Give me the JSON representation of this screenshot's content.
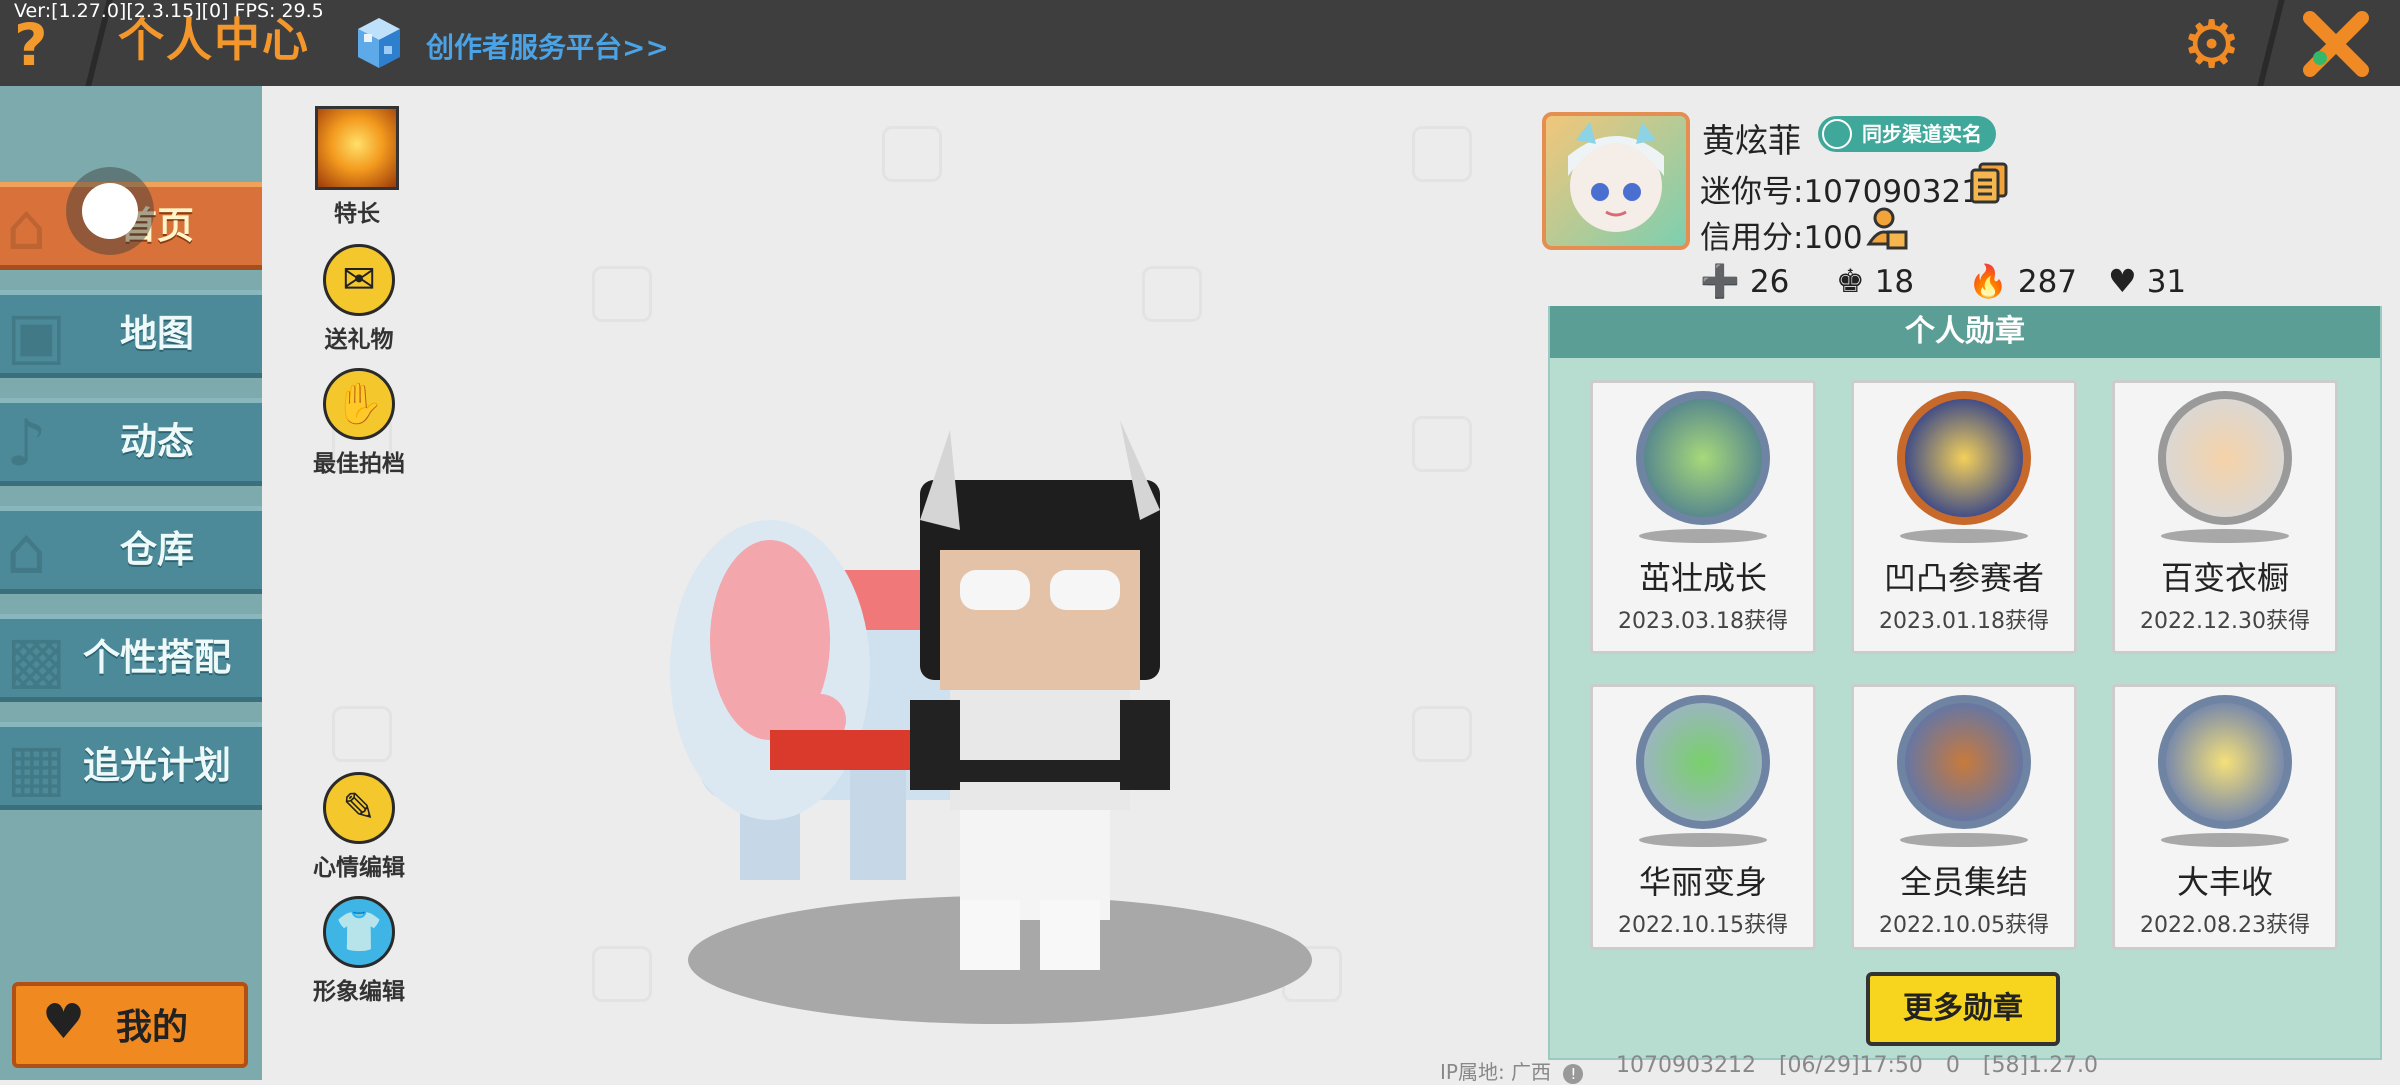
{
  "topbar": {
    "version": "Ver:[1.27.0][2.3.15][0] FPS: 29.5",
    "help_icon": "?",
    "title": "个人中心",
    "creator_platform": "创作者服务平台>>",
    "gear_icon": "⚙",
    "close_icon": "close-icon"
  },
  "sidebar": {
    "items": [
      {
        "label": "首页",
        "active": true
      },
      {
        "label": "地图"
      },
      {
        "label": "动态"
      },
      {
        "label": "仓库"
      },
      {
        "label": "个性搭配"
      },
      {
        "label": "追光计划"
      }
    ],
    "mine_label": "我的"
  },
  "functions": {
    "talent": "特长",
    "gift": "送礼物",
    "partner": "最佳拍档",
    "mood": "心情编辑",
    "image": "形象编辑"
  },
  "profile": {
    "username": "黄炫菲",
    "sync_label": "同步渠道实名",
    "mini_id": "迷你号:1070903212",
    "credit": "信用分:100",
    "stats": {
      "follow": "26",
      "fans": "18",
      "popularity": "287",
      "likes": "31"
    }
  },
  "medals": {
    "title": "个人勋章",
    "items": [
      {
        "name": "茁壮成长",
        "date": "2023.03.18获得",
        "color": "#6f84a2"
      },
      {
        "name": "凹凸参赛者",
        "date": "2023.01.18获得",
        "color": "#c8692c"
      },
      {
        "name": "百变衣橱",
        "date": "2022.12.30获得",
        "color": "#9a9a9a"
      },
      {
        "name": "华丽变身",
        "date": "2022.10.15获得",
        "color": "#6f84a2"
      },
      {
        "name": "全员集结",
        "date": "2022.10.05获得",
        "color": "#6f84a2"
      },
      {
        "name": "大丰收",
        "date": "2022.08.23获得",
        "color": "#6f84a2"
      }
    ],
    "more_label": "更多勋章"
  },
  "footer": {
    "ip": "IP属地: 广西",
    "info": "1070903212 [06/29]17:50 0 [58]1.27.0"
  }
}
